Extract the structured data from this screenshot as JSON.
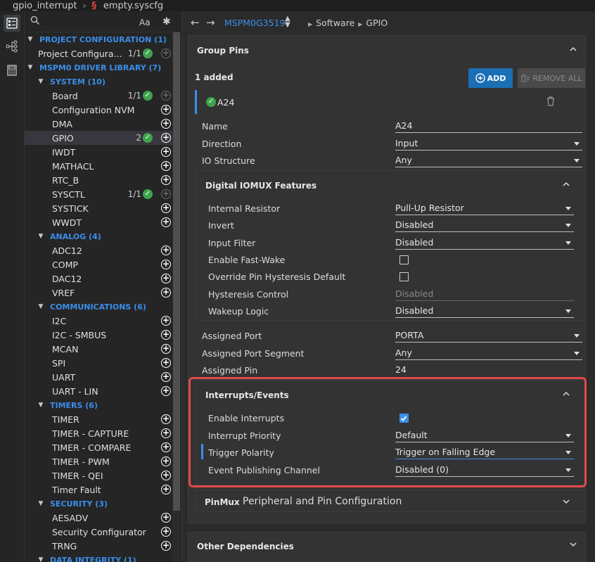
{
  "breadcrumb": {
    "project": "gpio_interrupt",
    "file": "empty.syscfg",
    "file_icon": "§"
  },
  "sidebar": {
    "search_placeholder": "",
    "match_case": "Aa",
    "filter_star": "✱",
    "rows": [
      {
        "kind": "cat",
        "level": 0,
        "label": "PROJECT CONFIGURATION (1)"
      },
      {
        "kind": "item",
        "level": 1,
        "label": "Project Configura...",
        "count": "1/1",
        "check": true,
        "plus_dim": true
      },
      {
        "kind": "cat",
        "level": 0,
        "label": "MSPM0 DRIVER LIBRARY (7)"
      },
      {
        "kind": "cat",
        "level": 1,
        "label": "SYSTEM (10)"
      },
      {
        "kind": "item",
        "level": 2,
        "label": "Board",
        "count": "1/1",
        "check": true,
        "plus_dim": true
      },
      {
        "kind": "item",
        "level": 2,
        "label": "Configuration NVM"
      },
      {
        "kind": "item",
        "level": 2,
        "label": "DMA"
      },
      {
        "kind": "item",
        "level": 2,
        "label": "GPIO",
        "count": "2",
        "check": true,
        "selected": true
      },
      {
        "kind": "item",
        "level": 2,
        "label": "IWDT"
      },
      {
        "kind": "item",
        "level": 2,
        "label": "MATHACL"
      },
      {
        "kind": "item",
        "level": 2,
        "label": "RTC_B"
      },
      {
        "kind": "item",
        "level": 2,
        "label": "SYSCTL",
        "count": "1/1",
        "check": true,
        "plus_dim": true
      },
      {
        "kind": "item",
        "level": 2,
        "label": "SYSTICK"
      },
      {
        "kind": "item",
        "level": 2,
        "label": "WWDT"
      },
      {
        "kind": "cat",
        "level": 1,
        "label": "ANALOG (4)"
      },
      {
        "kind": "item",
        "level": 2,
        "label": "ADC12"
      },
      {
        "kind": "item",
        "level": 2,
        "label": "COMP"
      },
      {
        "kind": "item",
        "level": 2,
        "label": "DAC12"
      },
      {
        "kind": "item",
        "level": 2,
        "label": "VREF"
      },
      {
        "kind": "cat",
        "level": 1,
        "label": "COMMUNICATIONS (6)"
      },
      {
        "kind": "item",
        "level": 2,
        "label": "I2C"
      },
      {
        "kind": "item",
        "level": 2,
        "label": "I2C - SMBUS"
      },
      {
        "kind": "item",
        "level": 2,
        "label": "MCAN"
      },
      {
        "kind": "item",
        "level": 2,
        "label": "SPI"
      },
      {
        "kind": "item",
        "level": 2,
        "label": "UART"
      },
      {
        "kind": "item",
        "level": 2,
        "label": "UART - LIN"
      },
      {
        "kind": "cat",
        "level": 1,
        "label": "TIMERS (6)"
      },
      {
        "kind": "item",
        "level": 2,
        "label": "TIMER"
      },
      {
        "kind": "item",
        "level": 2,
        "label": "TIMER - CAPTURE"
      },
      {
        "kind": "item",
        "level": 2,
        "label": "TIMER - COMPARE"
      },
      {
        "kind": "item",
        "level": 2,
        "label": "TIMER - PWM"
      },
      {
        "kind": "item",
        "level": 2,
        "label": "TIMER - QEI"
      },
      {
        "kind": "item",
        "level": 2,
        "label": "Timer Fault"
      },
      {
        "kind": "cat",
        "level": 1,
        "label": "SECURITY (3)"
      },
      {
        "kind": "item",
        "level": 2,
        "label": "AESADV"
      },
      {
        "kind": "item",
        "level": 2,
        "label": "Security Configurator"
      },
      {
        "kind": "item",
        "level": 2,
        "label": "TRNG"
      },
      {
        "kind": "cat",
        "level": 1,
        "label": "DATA INTEGRITY (1)"
      }
    ]
  },
  "nav": {
    "device": "MSPM0G3519",
    "crumbs": [
      "Software",
      "GPIO"
    ]
  },
  "group_pins": {
    "title": "Group Pins",
    "added": "1 added",
    "add_label": "ADD",
    "remove_label": "REMOVE ALL",
    "pin_name": "A24",
    "fields": [
      {
        "label": "Name",
        "value": "A24",
        "dropdown": false
      },
      {
        "label": "Direction",
        "value": "Input",
        "dropdown": true
      },
      {
        "label": "IO Structure",
        "value": "Any",
        "dropdown": true
      }
    ]
  },
  "digital": {
    "title": "Digital IOMUX Features",
    "fields": [
      {
        "label": "Internal Resistor",
        "value": "Pull-Up Resistor",
        "type": "dropdown"
      },
      {
        "label": "Invert",
        "value": "Disabled",
        "type": "dropdown"
      },
      {
        "label": "Input Filter",
        "value": "Disabled",
        "type": "dropdown"
      },
      {
        "label": "Enable Fast-Wake",
        "value": "",
        "type": "checkbox",
        "checked": false
      },
      {
        "label": "Override Pin Hysteresis Default",
        "value": "",
        "type": "checkbox",
        "checked": false
      },
      {
        "label": "Hysteresis Control",
        "value": "Disabled",
        "type": "disabled"
      },
      {
        "label": "Wakeup Logic",
        "value": "Disabled",
        "type": "dropdown"
      }
    ]
  },
  "port": {
    "fields": [
      {
        "label": "Assigned Port",
        "value": "PORTA",
        "type": "dropdown"
      },
      {
        "label": "Assigned Port Segment",
        "value": "Any",
        "type": "dropdown"
      },
      {
        "label": "Assigned Pin",
        "value": "24",
        "type": "text"
      }
    ]
  },
  "interrupts": {
    "title": "Interrupts/Events",
    "fields": [
      {
        "label": "Enable Interrupts",
        "value": "",
        "type": "checkbox",
        "checked": true
      },
      {
        "label": "Interrupt Priority",
        "value": "Default",
        "type": "dropdown"
      },
      {
        "label": "Trigger Polarity",
        "value": "Trigger on Falling Edge",
        "type": "dropdown",
        "focus": true
      },
      {
        "label": "Event Publishing Channel",
        "value": "Disabled (0)",
        "type": "dropdown"
      }
    ]
  },
  "pinmux": {
    "title": "PinMux",
    "subtitle": "Peripheral and Pin Configuration"
  },
  "other": {
    "title": "Other Dependencies"
  },
  "colors": {
    "accent": "#3b8eea",
    "highlight": "#e04a4a",
    "check": "#3fa34d",
    "add_button": "#1a6fb5"
  }
}
